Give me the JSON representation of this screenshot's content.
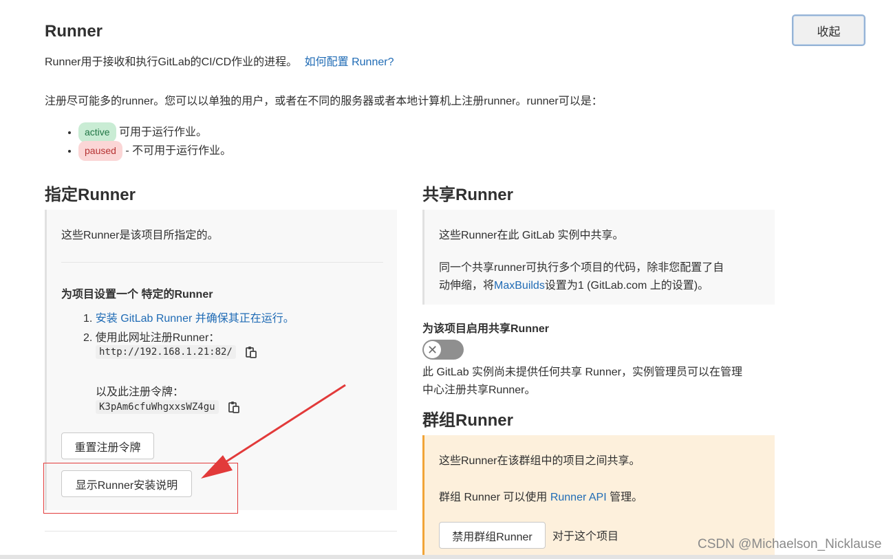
{
  "runner": {
    "title": "Runner",
    "intro_text": "Runner用于接收和执行GitLab的CI/CD作业的进程。",
    "intro_link": "如何配置 Runner?",
    "register_text": "注册尽可能多的runner。您可以以单独的用户，或者在不同的服务器或者本地计算机上注册runner。runner可以是：",
    "status_list": [
      {
        "badge": "active",
        "text": "可用于运行作业。"
      },
      {
        "badge": "paused",
        "text": "- 不可用于运行作业。"
      }
    ],
    "collapse_label": "收起"
  },
  "specific": {
    "title": "指定Runner",
    "description": "这些Runner是该项目所指定的。",
    "setup_heading": "为项目设置一个 特定的Runner",
    "step1_link": "安装 GitLab Runner 并确保其正在运行。",
    "step2_text": "使用此网址注册Runner：",
    "url": "http://192.168.1.21:82/",
    "token_label": "以及此注册令牌：",
    "token": "K3pAm6cfuWhgxxsWZ4gu",
    "reset_button": "重置注册令牌",
    "show_instructions_button": "显示Runner安装说明"
  },
  "shared": {
    "title": "共享Runner",
    "panel_text1": "这些Runner在此 GitLab 实例中共享。",
    "panel_text2a": "同一个共享runner可执行多个项目的代码，除非您配置了自",
    "panel_text2b_pre": "动伸缩，将",
    "panel_link": "MaxBuilds",
    "panel_text2b_post": "设置为1 (GitLab.com 上的设置)。",
    "enable_heading": "为该项目启用共享Runner",
    "toggle_state": "off",
    "note_line1": "此 GitLab 实例尚未提供任何共享 Runner，实例管理员可以在管理",
    "note_line2": "中心注册共享Runner。"
  },
  "group": {
    "title": "群组Runner",
    "text1": "这些Runner在该群组中的项目之间共享。",
    "text2_pre": "群组 Runner 可以使用 ",
    "text2_link": "Runner API",
    "text2_post": " 管理。",
    "disable_button": "禁用群组Runner",
    "disable_suffix": "对于这个项目"
  },
  "watermark": "CSDN @Michaelson_Nicklause",
  "colors": {
    "link": "#1f6bb5",
    "annotation_red": "#e23a3a",
    "warning_bg": "#fdf0dc",
    "warning_border": "#f1a437"
  }
}
